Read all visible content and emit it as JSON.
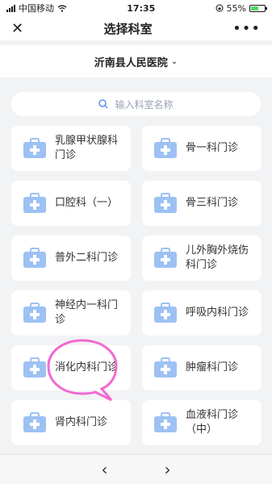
{
  "status_bar": {
    "carrier": "中国移动",
    "time": "17:35",
    "battery": "55%",
    "battery_level": 0.55
  },
  "nav": {
    "title": "选择科室",
    "close_icon": "close-icon",
    "more_icon": "more-icon"
  },
  "hospital": {
    "name": "沂南县人民医院",
    "chevron": "chevron-down-icon"
  },
  "search": {
    "placeholder": "输入科室名称",
    "icon": "search-icon"
  },
  "departments": [
    {
      "label": "乳腺甲状腺科门诊"
    },
    {
      "label": "骨一科门诊"
    },
    {
      "label": "口腔科（一）"
    },
    {
      "label": "骨三科门诊"
    },
    {
      "label": "普外二科门诊"
    },
    {
      "label": "儿外胸外烧伤科门诊"
    },
    {
      "label": "神经内一科门诊"
    },
    {
      "label": "呼吸内科门诊"
    },
    {
      "label": "消化内科门诊"
    },
    {
      "label": "肿瘤科门诊"
    },
    {
      "label": "肾内科门诊"
    },
    {
      "label": "血液科门诊（中）"
    }
  ],
  "colors": {
    "icon_blue": "#9dc1f3",
    "highlight_pink": "#f06ad1"
  },
  "bottom": {
    "back_icon": "chevron-left-icon",
    "forward_icon": "chevron-right-icon"
  }
}
